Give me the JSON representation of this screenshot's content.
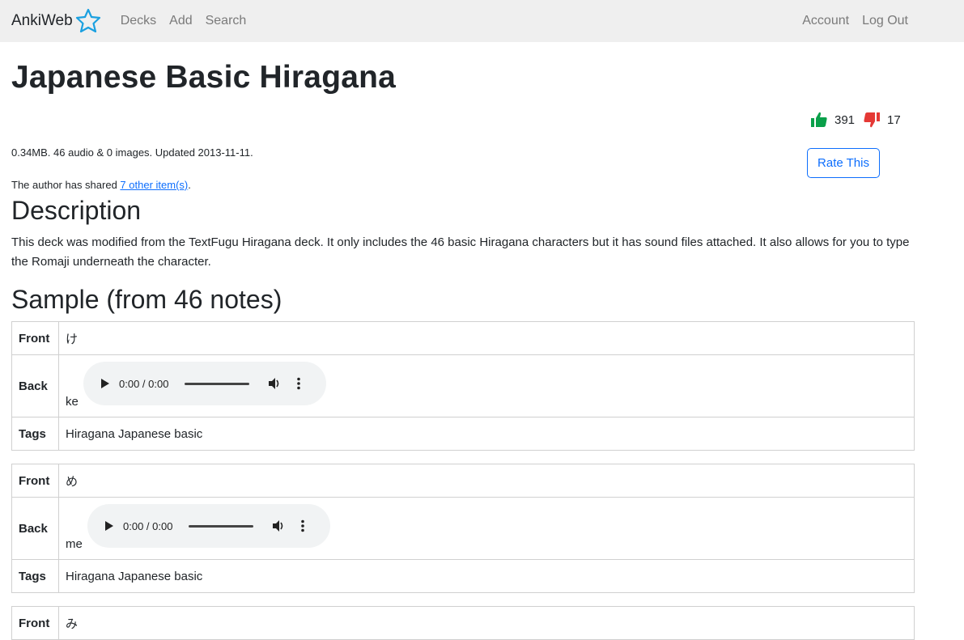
{
  "nav": {
    "brand": "AnkiWeb",
    "links": [
      "Decks",
      "Add",
      "Search"
    ],
    "right_links": [
      "Account",
      "Log Out"
    ],
    "accent": "#1aa0e0"
  },
  "deck": {
    "title": "Japanese Basic Hiragana",
    "meta": "0.34MB. 46 audio & 0 images. Updated 2013-11-11.",
    "shared_prefix": "The author has shared ",
    "shared_link": "7 other item(s)",
    "shared_suffix": ".",
    "thumbs_up": "391",
    "thumbs_down": "17",
    "rate_label": "Rate This"
  },
  "description": {
    "heading": "Description",
    "text": "This deck was modified from the TextFugu Hiragana deck. It only includes the 46 basic Hiragana characters but it has sound files attached. It also allows for you to type the Romaji underneath the character."
  },
  "sample": {
    "heading": "Sample (from 46 notes)",
    "labels": {
      "front": "Front",
      "back": "Back",
      "tags": "Tags"
    },
    "audio_time": "0:00 / 0:00",
    "notes": [
      {
        "front": "け",
        "back": "ke",
        "tags": "Hiragana Japanese basic"
      },
      {
        "front": "め",
        "back": "me",
        "tags": "Hiragana Japanese basic"
      },
      {
        "front": "み"
      }
    ]
  },
  "colors": {
    "up": "#0aa04a",
    "down": "#e53935",
    "link": "#0d6efd"
  }
}
